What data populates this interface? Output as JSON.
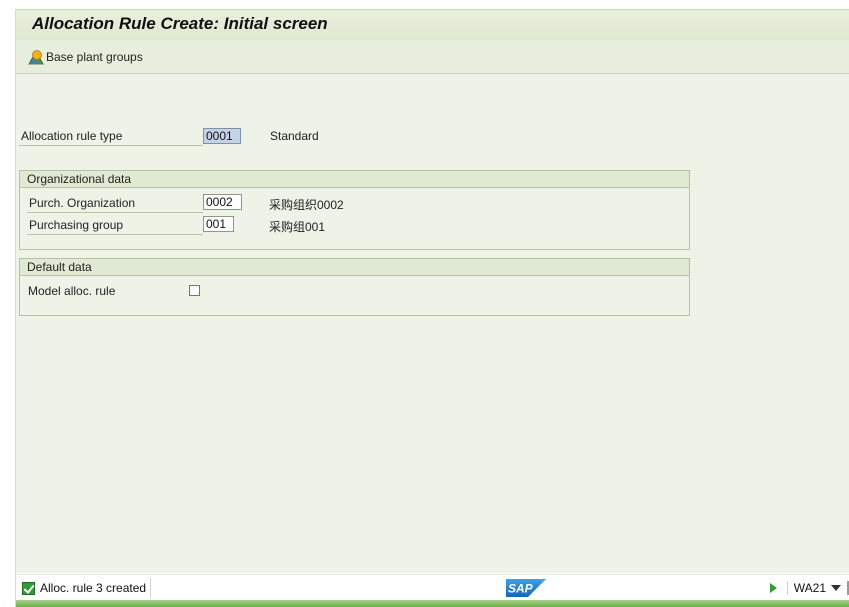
{
  "window": {
    "title": "Allocation Rule Create: Initial screen"
  },
  "toolbar": {
    "base_plant_groups": {
      "label": "Base plant groups",
      "icon": "plant-groups-icon"
    }
  },
  "form": {
    "allocation_rule_type": {
      "label": "Allocation rule type",
      "value": "0001",
      "description": "Standard"
    },
    "org_group": {
      "title": "Organizational data",
      "purch_org": {
        "label": "Purch. Organization",
        "value": "0002",
        "description": "采购组织0002"
      },
      "purch_group": {
        "label": "Purchasing group",
        "value": "001",
        "description": "采购组001"
      }
    },
    "default_group": {
      "title": "Default data",
      "model_alloc_rule": {
        "label": "Model alloc. rule",
        "checked": false
      }
    }
  },
  "status": {
    "message": "Alloc. rule 3 created",
    "message_type": "success",
    "logo": "SAP",
    "system": "WA21"
  },
  "colors": {
    "header_bg": "#e9f0dd",
    "content_bg": "#eef2e7",
    "success": "#2f9c35",
    "sap_blue": "#1a74c4"
  }
}
